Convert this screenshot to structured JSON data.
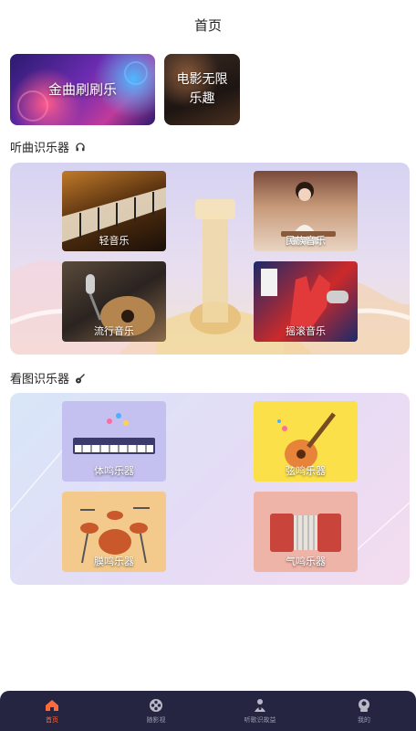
{
  "header": {
    "title": "首页"
  },
  "banners": [
    {
      "label": "金曲刷刷乐"
    },
    {
      "label_line1": "电影无限",
      "label_line2": "乐趣"
    }
  ],
  "section_listen": {
    "title": "听曲识乐器",
    "icon": "headphone-icon",
    "tiles": [
      {
        "label": "轻音乐"
      },
      {
        "label": "民族音乐"
      },
      {
        "label": "流行音乐"
      },
      {
        "label": "摇滚音乐"
      }
    ]
  },
  "section_view": {
    "title": "看图识乐器",
    "icon": "guitar-icon",
    "tiles": [
      {
        "label": "体鸣乐器"
      },
      {
        "label": "弦鸣乐器"
      },
      {
        "label": "膜鸣乐器"
      },
      {
        "label": "气鸣乐器"
      }
    ]
  },
  "tabbar": {
    "items": [
      {
        "label": "首页",
        "icon": "home-icon",
        "active": true
      },
      {
        "label": "随影视",
        "icon": "film-reel-icon",
        "active": false
      },
      {
        "label": "听歌识故益",
        "icon": "music-person-icon",
        "active": false
      },
      {
        "label": "我的",
        "icon": "profile-icon",
        "active": false
      }
    ]
  },
  "colors": {
    "accent": "#ff6a3d",
    "tabbar_bg": "#252541",
    "panel_listen_bg": "#d6d3f2",
    "panel_view_bg": "#e4dcf6"
  }
}
